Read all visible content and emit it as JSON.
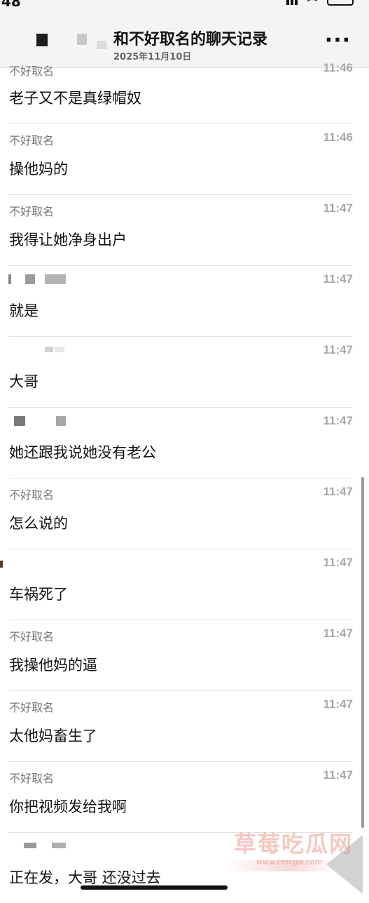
{
  "status_bar": {
    "time": "48"
  },
  "header": {
    "title": "和不好取名的聊天记录",
    "date": "2025年11月10日",
    "more_icon": "more-dots-icon"
  },
  "messages": [
    {
      "sender": "不好取名",
      "time": "11:46",
      "text": "老子又不是真绿帽奴"
    },
    {
      "sender": "不好取名",
      "time": "11:46",
      "text": "操他妈的"
    },
    {
      "sender": "不好取名",
      "time": "11:47",
      "text": "我得让她净身出户"
    },
    {
      "sender": "",
      "time": "11:47",
      "text": "就是"
    },
    {
      "sender": "",
      "time": "11:47",
      "text": "大哥"
    },
    {
      "sender": "",
      "time": "11:47",
      "text": "她还跟我说她没有老公"
    },
    {
      "sender": "不好取名",
      "time": "11:47",
      "text": "怎么说的"
    },
    {
      "sender": "",
      "time": "11:47",
      "text": "车祸死了"
    },
    {
      "sender": "不好取名",
      "time": "11:47",
      "text": "我操他妈的逼"
    },
    {
      "sender": "不好取名",
      "time": "11:47",
      "text": "太他妈畜生了"
    },
    {
      "sender": "不好取名",
      "time": "11:47",
      "text": "你把视频发给我啊"
    },
    {
      "sender": "",
      "time": "",
      "text": "正在发，大哥 还没过去"
    }
  ],
  "watermark": {
    "main": "草莓吃瓜网",
    "url": "www.cmcgw.com"
  }
}
